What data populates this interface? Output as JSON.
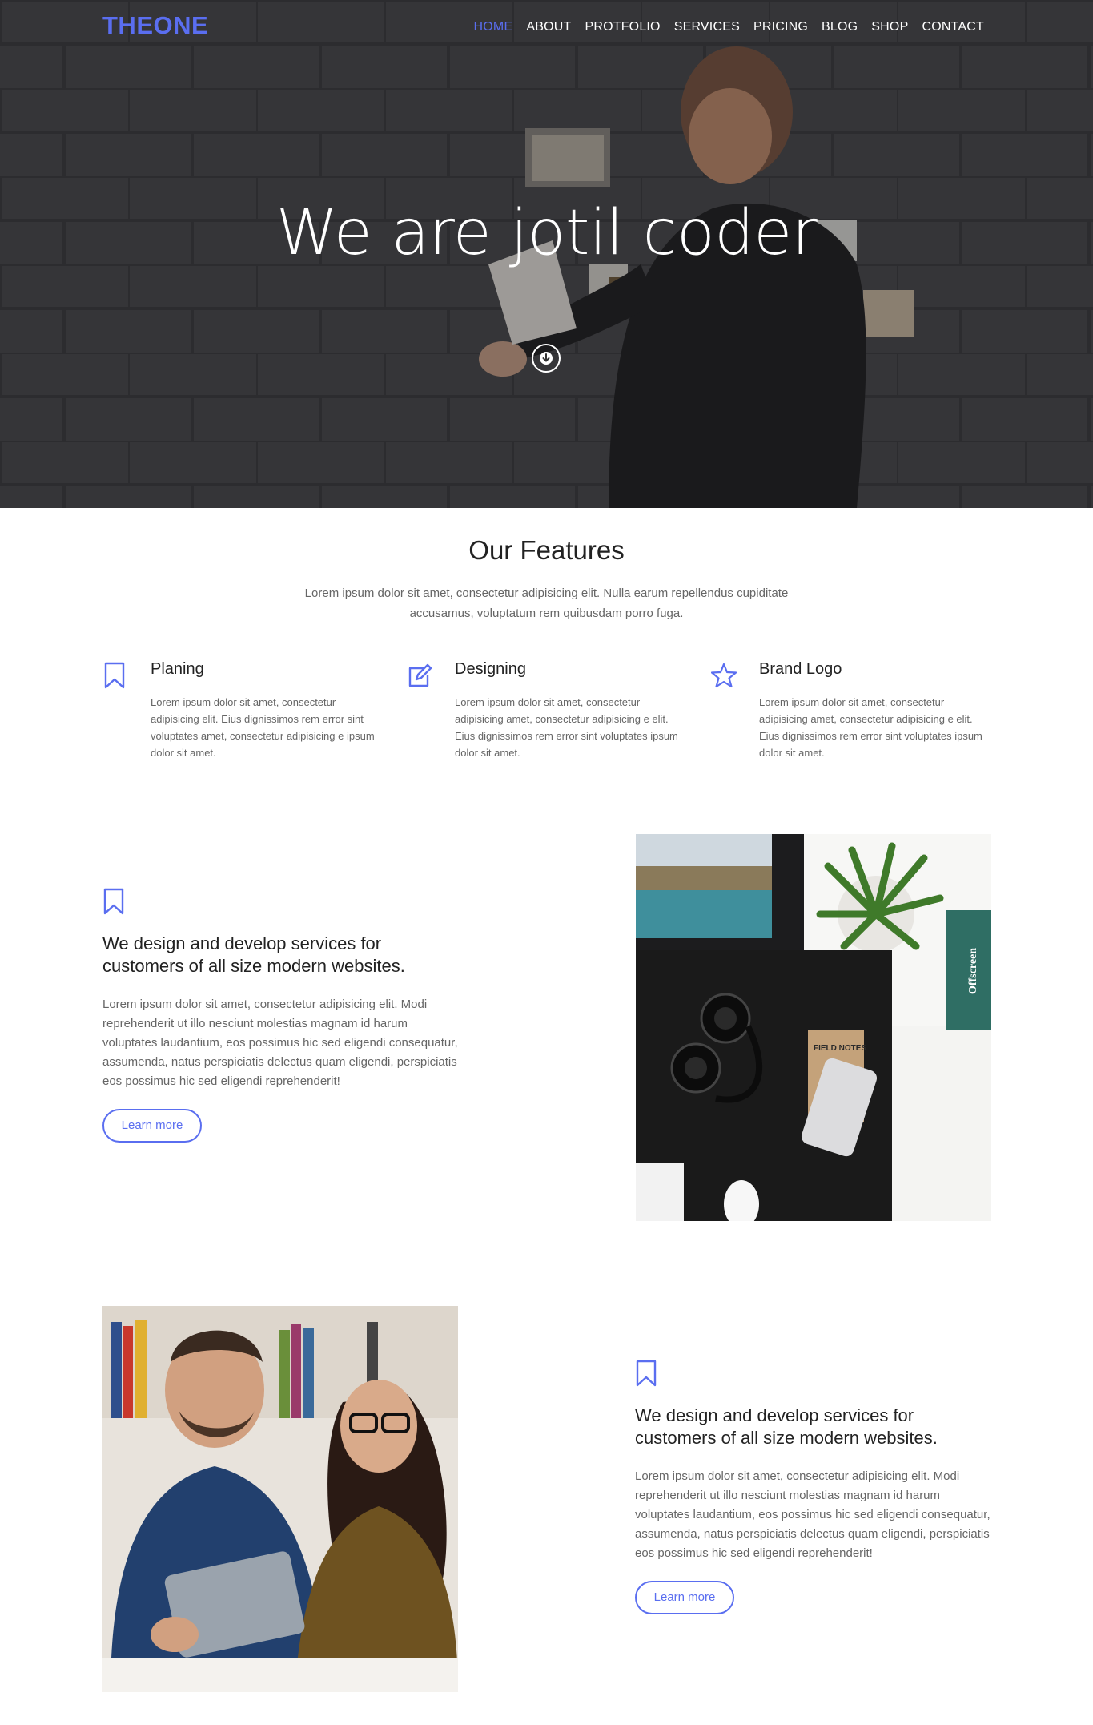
{
  "brand": {
    "logo": "THEONE",
    "accent": "#5a6ef0"
  },
  "nav": {
    "items": [
      "HOME",
      "ABOUT",
      "PROTFOLIO",
      "SERVICES",
      "PRICING",
      "BLOG",
      "SHOP",
      "CONTACT"
    ],
    "active": "HOME"
  },
  "hero": {
    "title": "We are jotil coder",
    "scroll_icon": "arrow-down-circle-icon"
  },
  "features": {
    "title": "Our Features",
    "subtitle": "Lorem ipsum dolor sit amet, consectetur adipisicing elit. Nulla earum repellendus cupiditate accusamus, voluptatum rem quibusdam porro fuga.",
    "items": [
      {
        "icon": "bookmark-icon",
        "title": "Planing",
        "text": "Lorem ipsum dolor sit amet, consectetur adipisicing elit. Eius dignissimos rem error sint voluptates amet, consectetur adipisicing e ipsum dolor sit amet."
      },
      {
        "icon": "edit-icon",
        "title": "Designing",
        "text": "Lorem ipsum dolor sit amet, consectetur adipisicing amet, consectetur adipisicing e elit. Eius dignissimos rem error sint voluptates ipsum dolor sit amet."
      },
      {
        "icon": "star-icon",
        "title": "Brand Logo",
        "text": "Lorem ipsum dolor sit amet, consectetur adipisicing amet, consectetur adipisicing e elit. Eius dignissimos rem error sint voluptates ipsum dolor sit amet."
      }
    ]
  },
  "services": [
    {
      "icon": "bookmark-icon",
      "title": "We design and develop services for customers of all size modern websites.",
      "text": "Lorem ipsum dolor sit amet, consectetur adipisicing elit. Modi reprehenderit ut illo nesciunt molestias magnam id harum voluptates laudantium, eos possimus hic sed eligendi consequatur, assumenda, natus perspiciatis delectus quam eligendi, perspiciatis eos possimus hic sed eligendi reprehenderit!",
      "button": "Learn more",
      "photo_labels": {
        "notebook": "FIELD NOTES",
        "book": "Offscreen"
      }
    },
    {
      "icon": "bookmark-icon",
      "title": "We design and develop services for customers of all size modern websites.",
      "text": "Lorem ipsum dolor sit amet, consectetur adipisicing elit. Modi reprehenderit ut illo nesciunt molestias magnam id harum voluptates laudantium, eos possimus hic sed eligendi consequatur, assumenda, natus perspiciatis delectus quam eligendi, perspiciatis eos possimus hic sed eligendi reprehenderit!",
      "button": "Learn more"
    }
  ]
}
